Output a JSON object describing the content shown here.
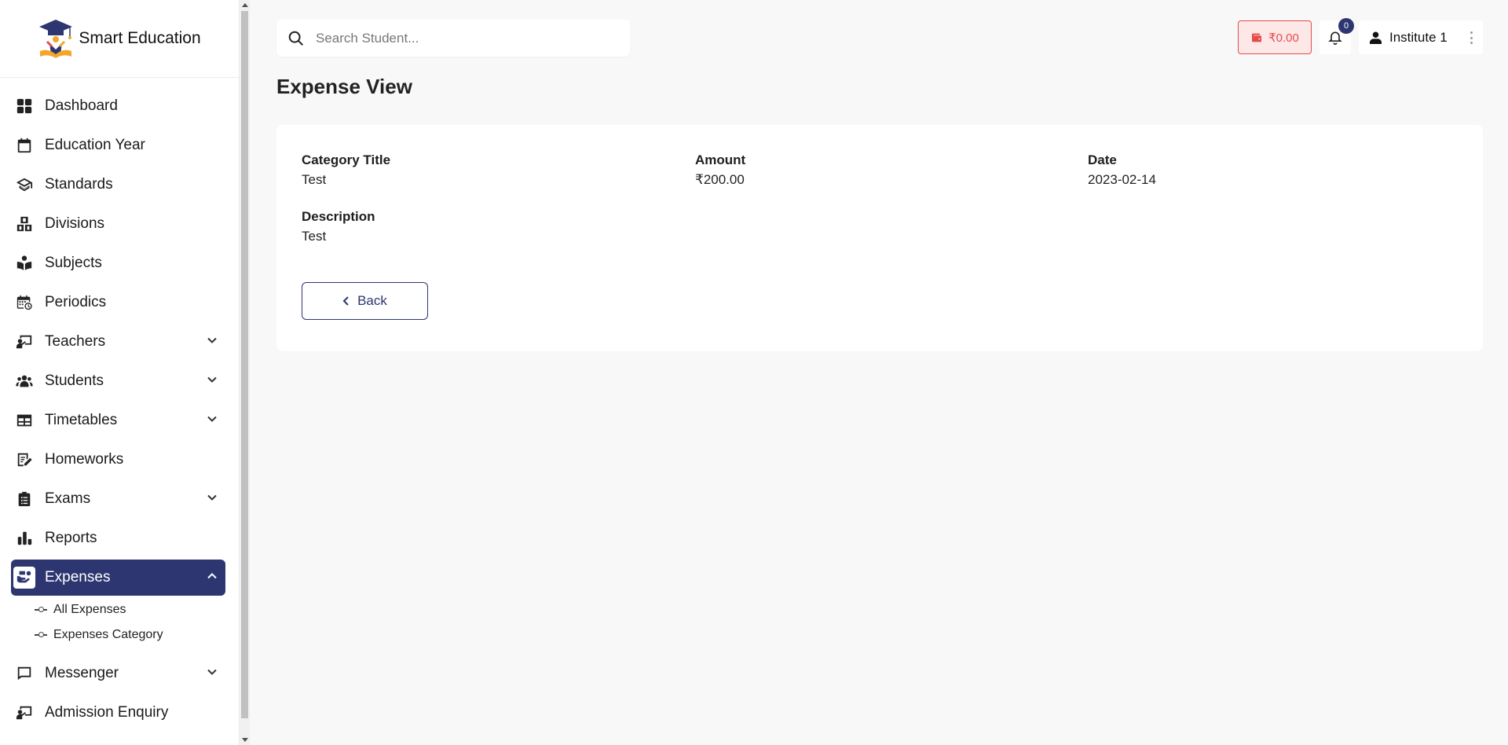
{
  "brand": {
    "name": "Smart Education"
  },
  "sidebar": {
    "items": [
      {
        "label": "Dashboard"
      },
      {
        "label": "Education Year"
      },
      {
        "label": "Standards"
      },
      {
        "label": "Divisions"
      },
      {
        "label": "Subjects"
      },
      {
        "label": "Periodics"
      },
      {
        "label": "Teachers"
      },
      {
        "label": "Students"
      },
      {
        "label": "Timetables"
      },
      {
        "label": "Homeworks"
      },
      {
        "label": "Exams"
      },
      {
        "label": "Reports"
      },
      {
        "label": "Expenses"
      },
      {
        "label": "Messenger"
      },
      {
        "label": "Admission Enquiry"
      }
    ],
    "expenses_sub": [
      {
        "label": "All Expenses"
      },
      {
        "label": "Expenses Category"
      }
    ]
  },
  "header": {
    "search_placeholder": "Search Student...",
    "wallet_amount": "₹0.00",
    "notification_count": "0",
    "user_name": "Institute 1"
  },
  "page": {
    "title": "Expense View"
  },
  "expense": {
    "category_title_label": "Category Title",
    "category_title": "Test",
    "amount_label": "Amount",
    "amount": "₹200.00",
    "date_label": "Date",
    "date": "2023-02-14",
    "description_label": "Description",
    "description": "Test"
  },
  "actions": {
    "back_label": "Back"
  },
  "colors": {
    "primary": "#2d3670",
    "danger": "#e64b4b",
    "background": "#f8f8f8"
  }
}
